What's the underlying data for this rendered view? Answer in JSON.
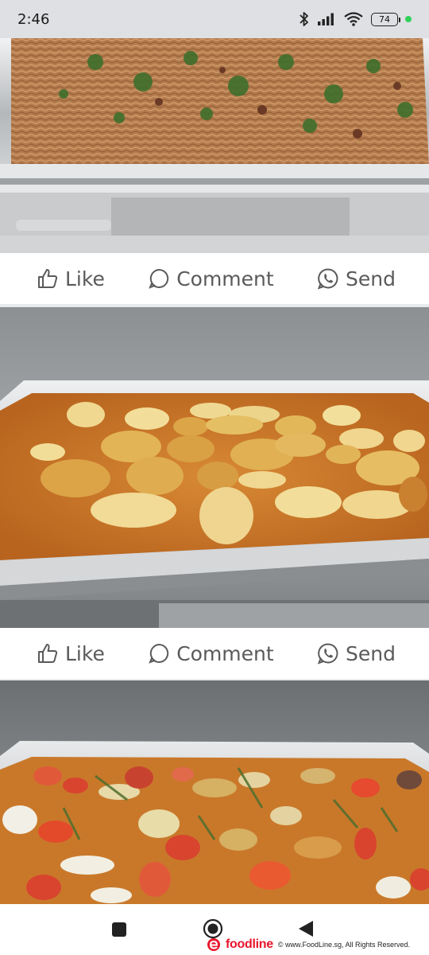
{
  "status": {
    "time": "2:46",
    "battery": "74",
    "icons": [
      "bluetooth-icon",
      "signal-icon",
      "wifi-icon",
      "battery-icon",
      "active-dot"
    ]
  },
  "posts": [
    {
      "photo": "fried-bee-hoon-tray",
      "like_label": "Like",
      "comment_label": "Comment",
      "send_label": "Send"
    },
    {
      "photo": "curry-potato-tray",
      "like_label": "Like",
      "comment_label": "Comment",
      "send_label": "Send"
    },
    {
      "photo": "vegetable-curry-tray"
    }
  ],
  "nav": {
    "items": [
      "recents-square-icon",
      "home-circle-icon",
      "back-triangle-icon"
    ]
  },
  "footer": {
    "brand": "foodline",
    "copyright": "© www.FoodLine.sg, All Rights Reserved."
  },
  "colors": {
    "accent_red": "#e8162c",
    "action_text": "#5a5a5a",
    "status_bg": "#dfe0e3",
    "active_dot": "#2fd15b"
  }
}
